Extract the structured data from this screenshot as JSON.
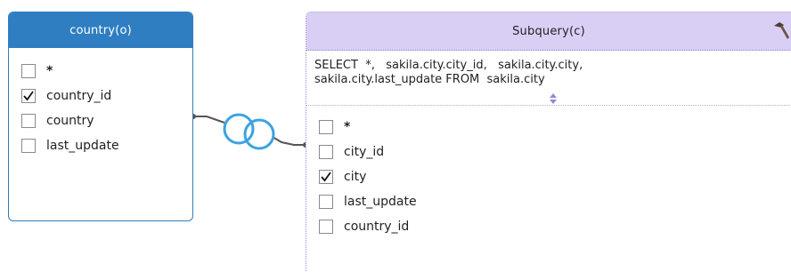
{
  "left_table": {
    "title": "country(o)",
    "fields": [
      {
        "label": "*",
        "checked": false
      },
      {
        "label": "country_id",
        "checked": true
      },
      {
        "label": "country",
        "checked": false
      },
      {
        "label": "last_update",
        "checked": false
      }
    ]
  },
  "subquery": {
    "title": "Subquery(c)",
    "sql": "SELECT  *,   sakila.city.city_id,   sakila.city.city,\nsakila.city.last_update FROM  sakila.city",
    "fields": [
      {
        "label": "*",
        "checked": false
      },
      {
        "label": "city_id",
        "checked": false
      },
      {
        "label": "city",
        "checked": true
      },
      {
        "label": "last_update",
        "checked": false
      },
      {
        "label": "country_id",
        "checked": false
      }
    ]
  },
  "join": {
    "type": "inner-join",
    "icon": "venn-overlap-icon"
  },
  "colors": {
    "table_header": "#2f7ec1",
    "subquery_header": "#d9cff5",
    "join_icon": "#3ba3e0",
    "connector_line": "#555555"
  }
}
